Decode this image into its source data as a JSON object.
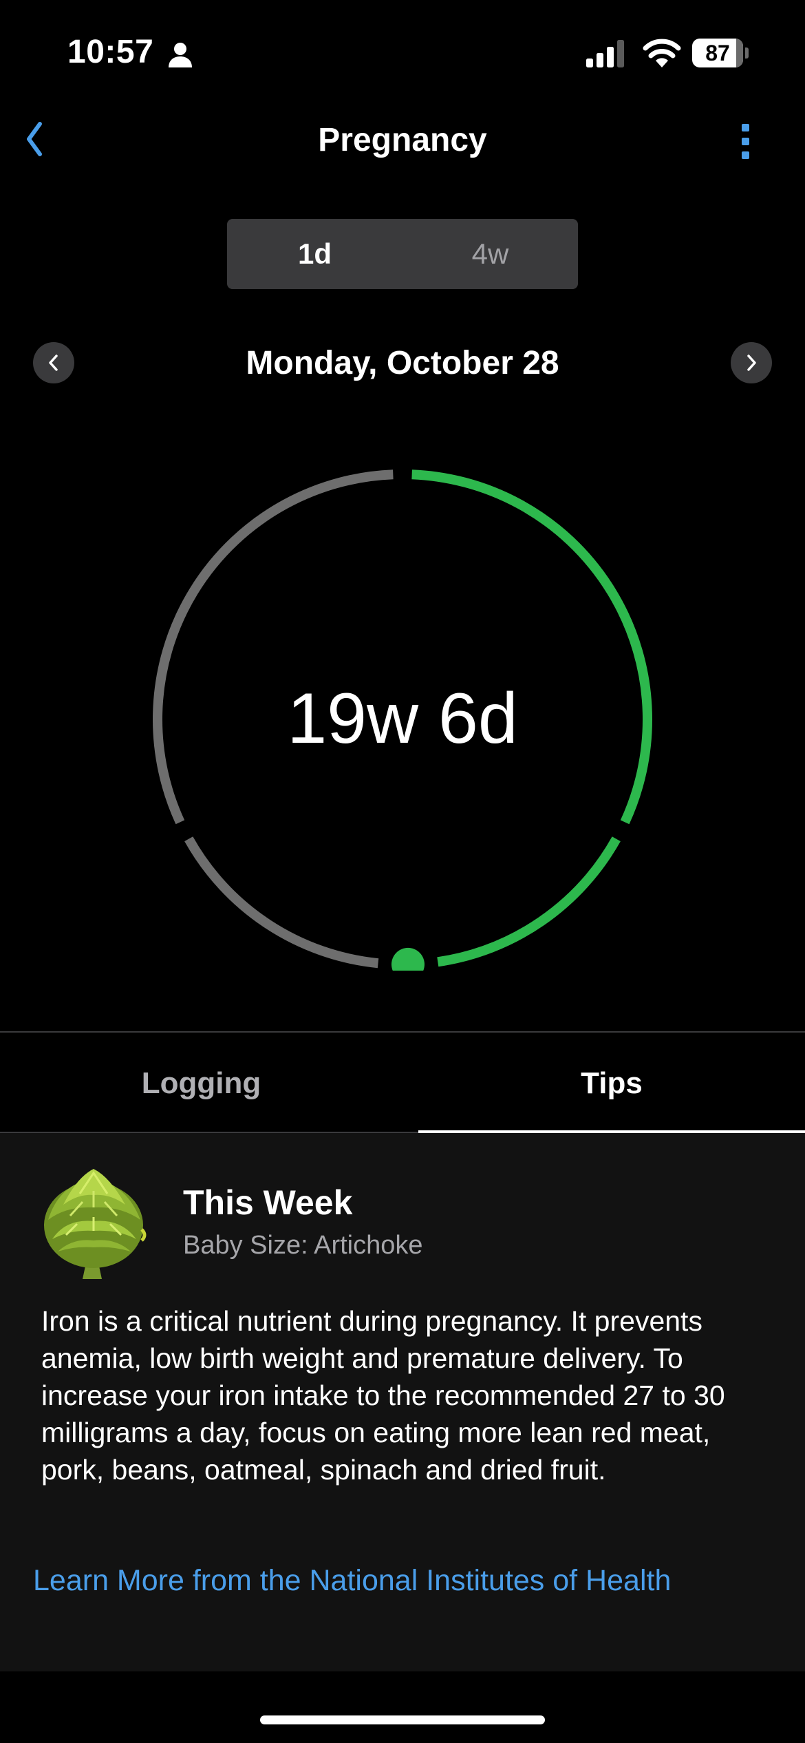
{
  "status_bar": {
    "time": "10:57",
    "battery_level": "87",
    "battery_fraction": 0.87
  },
  "header": {
    "title": "Pregnancy"
  },
  "range_selector": {
    "options": [
      "1d",
      "4w"
    ],
    "selected": "1d"
  },
  "date_nav": {
    "label": "Monday, October 28"
  },
  "progress_ring": {
    "value_text": "19w 6d",
    "weeks_elapsed": 19,
    "days_elapsed": 6,
    "total_weeks": 40,
    "colors": {
      "elapsed": "#2db84d",
      "remaining": "#6e6e6e"
    }
  },
  "tabs": {
    "items": [
      "Logging",
      "Tips"
    ],
    "selected": "Tips"
  },
  "tips": {
    "title": "This Week",
    "baby_size": "Baby Size: Artichoke",
    "icon": "artichoke-icon",
    "body": "Iron is a critical nutrient during pregnancy. It prevents anemia, low birth weight and premature delivery. To increase your iron intake to the recommended 27 to 30 milligrams a day, focus on eating more lean red meat, pork, beans, oatmeal, spinach and dried fruit.",
    "link": "Learn More from the National Institutes of Health"
  },
  "colors": {
    "accent": "#4a9eea",
    "progress": "#2db84d"
  }
}
